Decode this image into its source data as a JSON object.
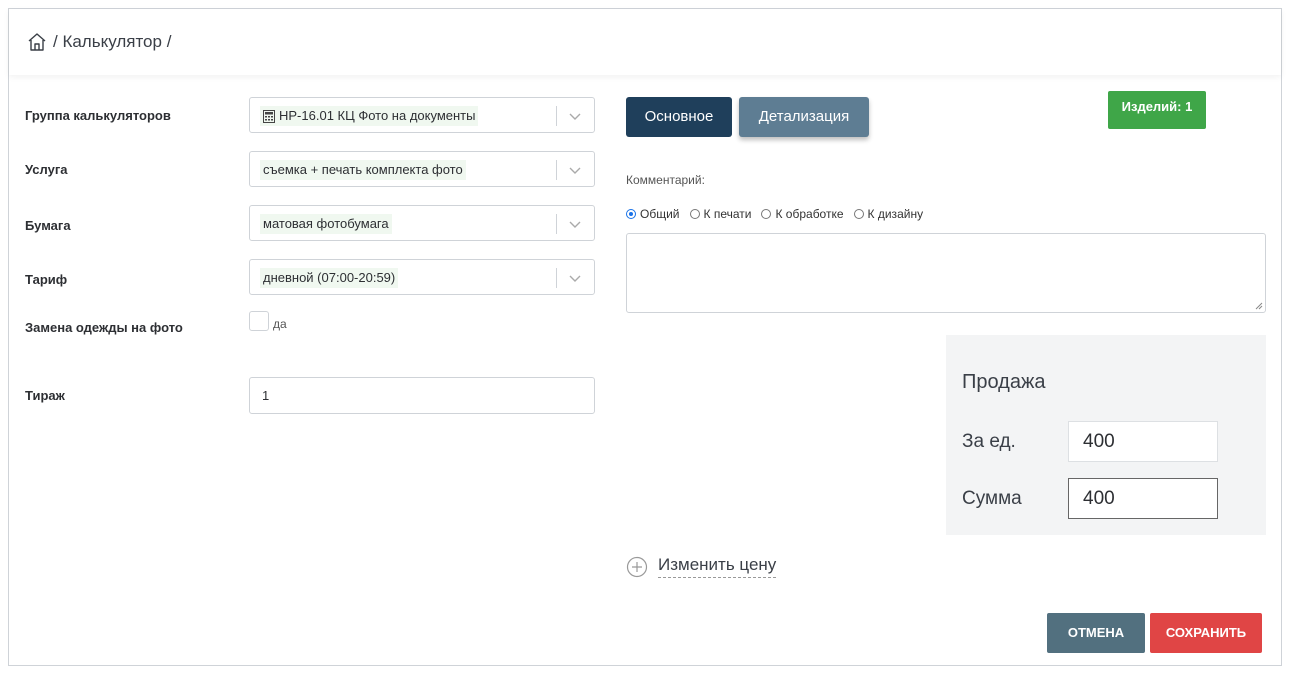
{
  "breadcrumb": {
    "home_icon": "home-icon",
    "text": "/ Калькулятор /"
  },
  "form": {
    "group_label": "Группа калькуляторов",
    "group_value": "HP-16.01 КЦ Фото на документы",
    "group_icon": "calculator-icon",
    "service_label": "Услуга",
    "service_value": "съемка + печать комплекта фото",
    "paper_label": "Бумага",
    "paper_value": "матовая фотобумага",
    "tariff_label": "Тариф",
    "tariff_value": "дневной (07:00-20:59)",
    "clothes_label": "Замена одежды на фото",
    "clothes_checkbox_label": "да",
    "clothes_checked": false,
    "run_label": "Тираж",
    "run_value": "1"
  },
  "tabs": {
    "main": "Основное",
    "detail": "Детализация"
  },
  "items_badge": "Изделий: 1",
  "comment": {
    "label": "Комментарий:",
    "options": [
      "Общий",
      "К печати",
      "К обработке",
      "К дизайну"
    ],
    "selected": "Общий",
    "value": ""
  },
  "sale": {
    "title": "Продажа",
    "unit_label": "За ед.",
    "unit_value": "400",
    "sum_label": "Сумма",
    "sum_value": "400"
  },
  "change_price": "Изменить цену",
  "buttons": {
    "cancel": "ОТМЕНА",
    "save": "СОХРАНИТЬ"
  },
  "colors": {
    "primary_dark": "#1f3f5b",
    "secondary": "#5e7d93",
    "badge_green": "#3fa648",
    "cancel": "#52707f",
    "save_red": "#e04545"
  }
}
